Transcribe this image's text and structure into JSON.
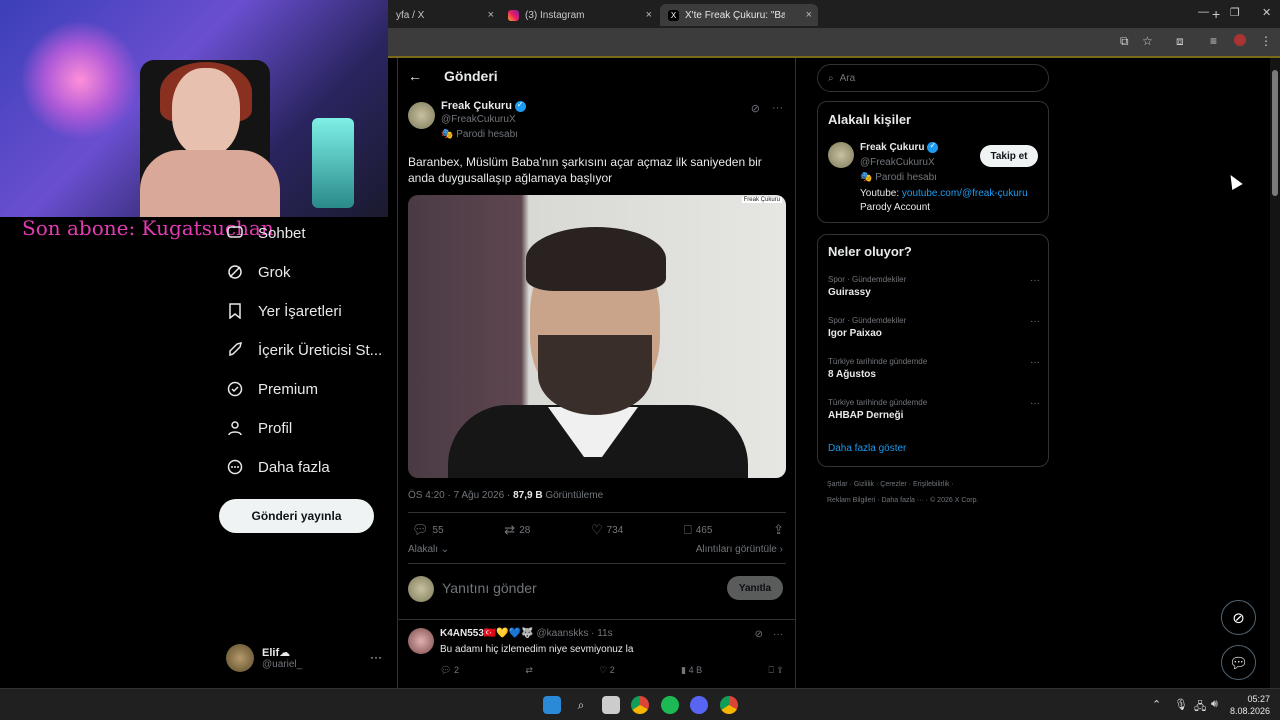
{
  "browser": {
    "tabs": [
      {
        "label": "yfa / X"
      },
      {
        "label": "(3) Instagram"
      },
      {
        "label": "X'te Freak Çukuru: \"Baranb"
      }
    ],
    "new_tab": "+",
    "close_glyph": "×"
  },
  "stream": {
    "subscriber_label": "Son abone: Kugatsuchan"
  },
  "nav": {
    "items": [
      {
        "label": "Sohbet",
        "icon": "chat-icon"
      },
      {
        "label": "Grok",
        "icon": "grok-icon"
      },
      {
        "label": "Yer İşaretleri",
        "icon": "bookmark-icon"
      },
      {
        "label": "İçerik Üreticisi St...",
        "icon": "rocket-icon"
      },
      {
        "label": "Premium",
        "icon": "verified-icon"
      },
      {
        "label": "Profil",
        "icon": "person-icon"
      },
      {
        "label": "Daha fazla",
        "icon": "more-circle-icon"
      }
    ],
    "post_button": "Gönderi yayınla",
    "account": {
      "name": "Elif☁",
      "handle": "@uariel_",
      "more": "···"
    }
  },
  "post": {
    "header_title": "Gönderi",
    "author": {
      "name": "Freak Çukuru",
      "handle": "@FreakCukuruX",
      "parody": "Parodi hesabı"
    },
    "text": "Baranbex, Müslüm Baba'nın şarkısını açar açmaz ilk saniyeden bir anda duygusallaşıp ağlamaya başlıyor",
    "media_watermark": "Freak Çukuru",
    "timestamp": "ÖS 4:20 · 7 Ağu 2026 · ",
    "views": "87,9 B",
    "views_label": " Görüntüleme",
    "stats": {
      "replies": "55",
      "reposts": "28",
      "likes": "734",
      "bookmarks": "465"
    },
    "relevant": "Alakalı",
    "quotes": "Alıntıları görüntüle",
    "reply_placeholder": "Yanıtını gönder",
    "reply_button": "Yanıtla"
  },
  "comment": {
    "name": "K4AN553🇹🇷💛💙🐺",
    "handle": "@kaanskks · 11s",
    "text": "Bu adamı hiç izlemedim niye sevmiyonuz la",
    "replies": "2",
    "likes": "2",
    "views": "4 B"
  },
  "sidebar": {
    "search_placeholder": "Ara",
    "relevant_title": "Alakalı kişiler",
    "person": {
      "name": "Freak Çukuru",
      "handle": "@FreakCukuruX",
      "parody": "Parodi hesabı",
      "youtube_label": "Youtube: ",
      "youtube_link": "youtube.com/@freak-çukuru",
      "bio_line2": "Parody Account",
      "follow_button": "Takip et"
    },
    "trends_title": "Neler oluyor?",
    "trends": [
      {
        "category": "Spor · Gündemdekiler",
        "name": "Guirassy"
      },
      {
        "category": "Spor · Gündemdekiler",
        "name": "Igor Paixao"
      },
      {
        "category": "Türkiye tarihinde gündemde",
        "name": "8 Ağustos"
      },
      {
        "category": "Türkiye tarihinde gündemde",
        "name": "AHBAP Derneği"
      }
    ],
    "show_more": "Daha fazla göster",
    "footer_line1": "Şartlar  ·  Gizlilik  ·  Çerezler  ·  Erişilebilirlik  ·",
    "footer_line2": "Reklam Bilgileri  ·  Daha fazla ···  ·  © 2026 X Corp."
  },
  "taskbar": {
    "time": "05:27",
    "date": "8.08.2026"
  },
  "colors": {
    "accent": "#1d9bf0",
    "subscriber": "#e33bb4",
    "background": "#000000"
  }
}
